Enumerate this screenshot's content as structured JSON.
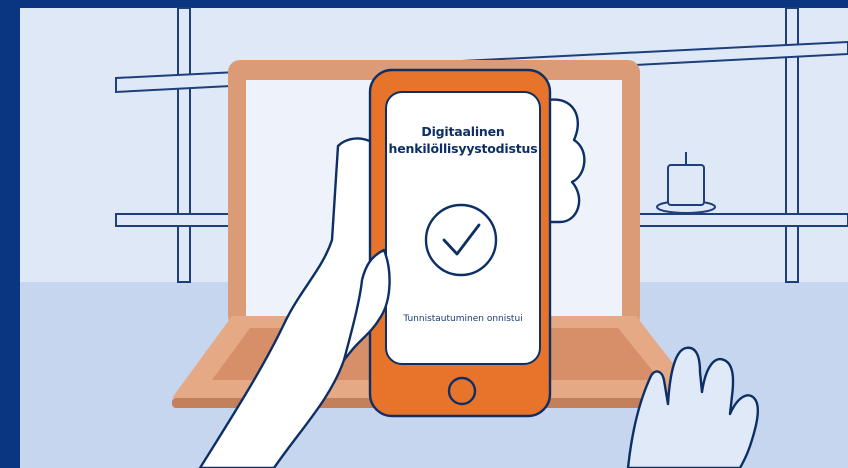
{
  "phone": {
    "title_line1": "Digitaalinen",
    "title_line2": "henkilöllisyystodistus",
    "status": "Tunnistautuminen onnistui",
    "check_icon": "checkmark-circle-icon",
    "home_button_icon": "home-button-icon"
  },
  "colors": {
    "border": "#0a3580",
    "wall": "#dfe8f6",
    "floor": "#c6d6ee",
    "shelf_outline": "#1d3f7a",
    "laptop": "#dc9b77",
    "laptop_screen": "#eef3fb",
    "phone_body": "#e8732a",
    "phone_screen": "#ffffff",
    "ink": "#0d2f66",
    "hand": "#ffffff",
    "hand_right": "#dfe9f8"
  }
}
